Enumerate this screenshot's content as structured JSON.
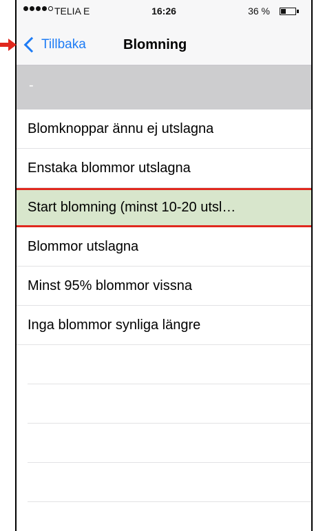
{
  "status_bar": {
    "carrier": "TELIA  E",
    "time": "16:26",
    "battery": "36 %",
    "battery_level": 0.36
  },
  "nav": {
    "back_label": "Tillbaka",
    "title": "Blomning"
  },
  "section_header": "-",
  "options": [
    "Blomknoppar ännu ej utslagna",
    "Enstaka blommor utslagna",
    "Start blomning (minst 10-20 utsl…",
    "Blommor utslagna",
    "Minst 95% blommor vissna",
    "Inga blommor synliga längre"
  ],
  "selected_index": 2,
  "colors": {
    "accent": "#1e7cf5",
    "selected_bg": "#d8e6cc",
    "highlight": "#e0281e"
  },
  "annotation": {
    "arrow_icon": "red-arrow-icon"
  }
}
